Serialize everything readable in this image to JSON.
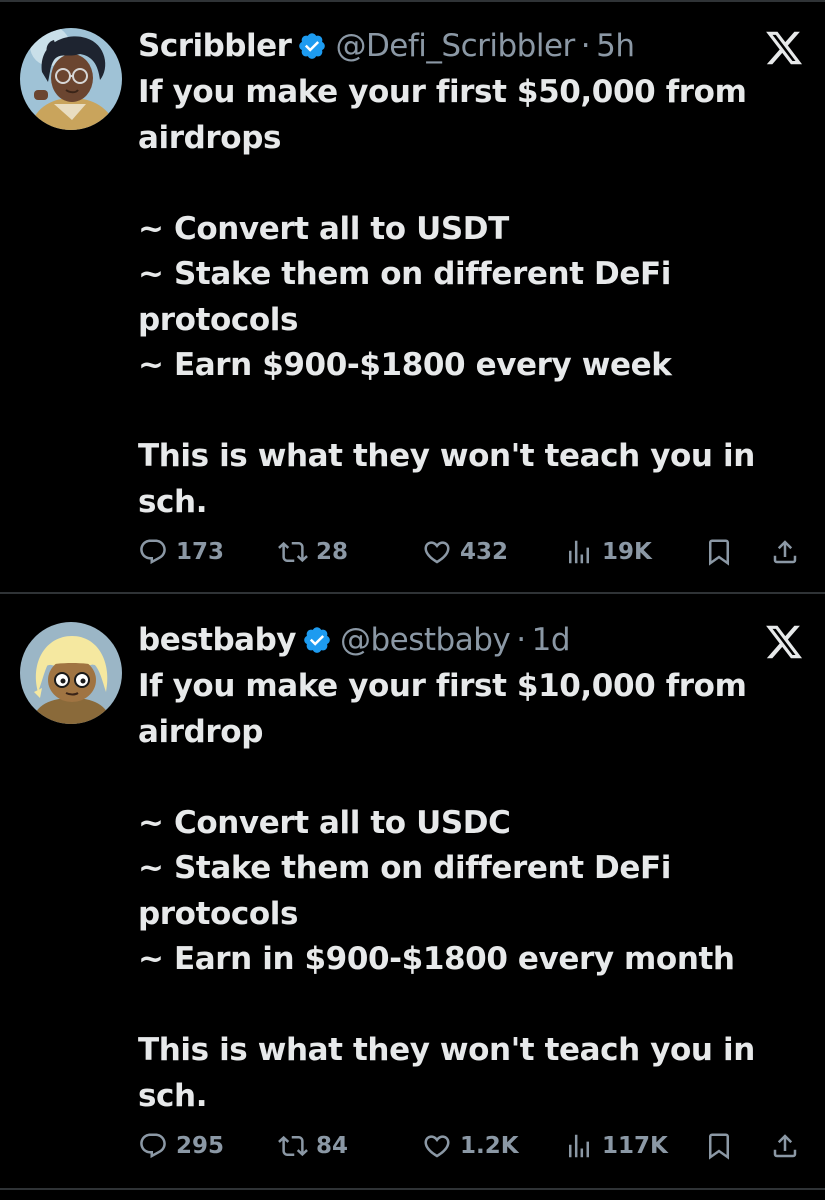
{
  "tweets": [
    {
      "display_name": "Scribbler",
      "handle": "@Defi_Scribbler",
      "separator": "·",
      "time": "5h",
      "lines": [
        "If you make your first $50,000 from",
        "airdrops",
        "",
        "~ Convert all to USDT",
        "~ Stake them on different DeFi",
        "protocols",
        "~ Earn $900-$1800 every week",
        "",
        "This is what they won't teach you in",
        "sch."
      ],
      "stats": {
        "replies": "173",
        "reposts": "28",
        "likes": "432",
        "views": "19K"
      }
    },
    {
      "display_name": "bestbaby",
      "handle": "@bestbaby",
      "separator": "·",
      "time": "1d",
      "lines": [
        "If you make your first $10,000 from",
        "airdrop",
        "",
        "~ Convert all to USDC",
        "~ Stake them on different DeFi",
        "protocols",
        "~ Earn in $900-$1800 every month",
        "",
        "This is what they won't teach you in",
        "sch."
      ],
      "stats": {
        "replies": "295",
        "reposts": "84",
        "likes": "1.2K",
        "views": "117K"
      }
    }
  ],
  "icons": {
    "verified": "verified-badge-icon",
    "x_logo": "x-logo-icon",
    "reply": "reply-icon",
    "repost": "repost-icon",
    "like": "heart-icon",
    "views": "views-chart-icon",
    "bookmark": "bookmark-icon",
    "share": "share-icon"
  },
  "colors": {
    "background": "#000000",
    "text_primary": "#e7e9ea",
    "text_secondary": "#8b98a5",
    "verified": "#1d9bf0",
    "divider": "#2f3336"
  }
}
